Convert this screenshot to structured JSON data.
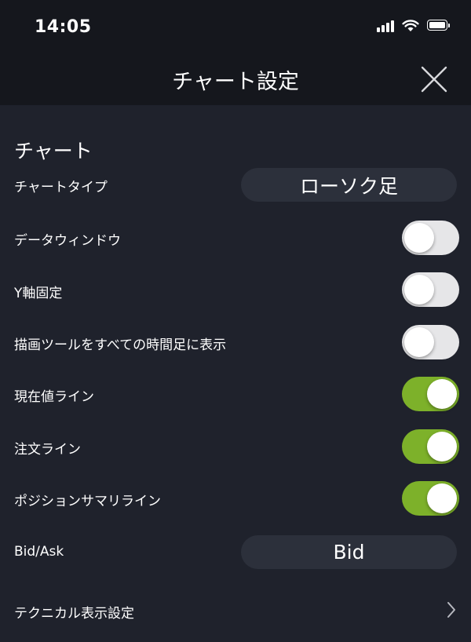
{
  "status_bar": {
    "time": "14:05"
  },
  "header": {
    "title": "チャート設定",
    "close_icon": "close-icon"
  },
  "section": {
    "title": "チャート"
  },
  "settings": {
    "chart_type": {
      "label": "チャートタイプ",
      "value": "ローソク足"
    },
    "data_window": {
      "label": "データウィンドウ",
      "on": false
    },
    "y_axis_fixed": {
      "label": "Y軸固定",
      "on": false
    },
    "drawing_tools_all_timeframes": {
      "label": "描画ツールをすべての時間足に表示",
      "on": false
    },
    "current_price_line": {
      "label": "現在値ライン",
      "on": true
    },
    "order_line": {
      "label": "注文ライン",
      "on": true
    },
    "position_summary_line": {
      "label": "ポジションサマリライン",
      "on": true
    },
    "bid_ask": {
      "label": "Bid/Ask",
      "value": "Bid"
    },
    "technical_display_settings": {
      "label": "テクニカル表示設定",
      "icon": "chevron-right-icon"
    }
  },
  "colors": {
    "background": "#1f222c",
    "header": "#15171d",
    "toggle_on": "#7db12a",
    "toggle_off": "#e6e6e8",
    "pill": "#2c303b"
  }
}
